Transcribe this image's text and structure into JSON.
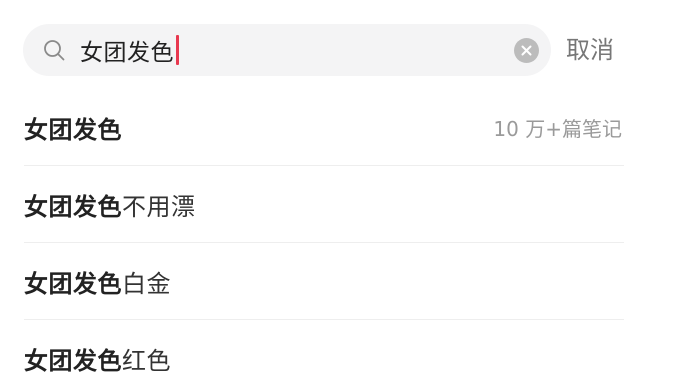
{
  "search": {
    "query": "女团发色",
    "cancel_label": "取消"
  },
  "suggestions": [
    {
      "match": "女团发色",
      "rest": "",
      "meta": "10 万+篇笔记"
    },
    {
      "match": "女团发色",
      "rest": "不用漂",
      "meta": ""
    },
    {
      "match": "女团发色",
      "rest": "白金",
      "meta": ""
    },
    {
      "match": "女团发色",
      "rest": "红色",
      "meta": ""
    }
  ],
  "colors": {
    "caret": "#e8384f",
    "search_background": "#f4f4f5",
    "clear_button": "#bcbcbc"
  },
  "icons": {
    "search": "search-icon",
    "clear": "clear-icon"
  }
}
